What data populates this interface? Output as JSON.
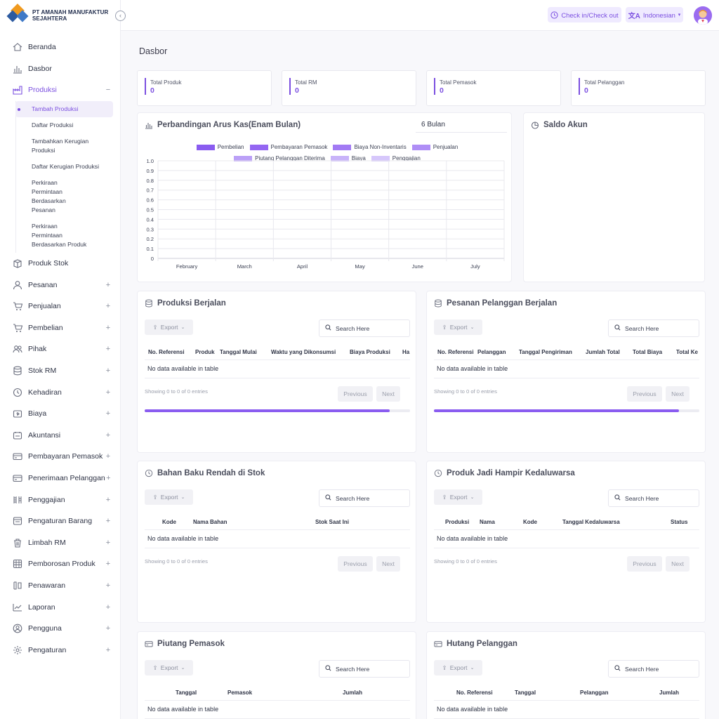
{
  "brand": {
    "name": "PT AMANAH MANUFAKTUR SEJAHTERA"
  },
  "topbar": {
    "check_label": "Check in/Check out",
    "lang_label": "Indonesian"
  },
  "sidebar": {
    "items": [
      {
        "label": "Beranda",
        "icon": "home-icon"
      },
      {
        "label": "Dasbor",
        "icon": "chart-icon"
      },
      {
        "label": "Produksi",
        "icon": "factory-icon",
        "toggle": "−"
      },
      {
        "label": "Produk Stok",
        "icon": "box-icon"
      },
      {
        "label": "Pesanan",
        "icon": "user-icon",
        "toggle": "+"
      },
      {
        "label": "Penjualan",
        "icon": "cart-icon",
        "toggle": "+"
      },
      {
        "label": "Pembelian",
        "icon": "cart-icon",
        "toggle": "+"
      },
      {
        "label": "Pihak",
        "icon": "users-icon",
        "toggle": "+"
      },
      {
        "label": "Stok RM",
        "icon": "database-icon",
        "toggle": "+"
      },
      {
        "label": "Kehadiran",
        "icon": "clock-icon",
        "toggle": "+"
      },
      {
        "label": "Biaya",
        "icon": "wallet-icon",
        "toggle": "+"
      },
      {
        "label": "Akuntansi",
        "icon": "calculator-icon",
        "toggle": "+"
      },
      {
        "label": "Pembayaran Pemasok",
        "icon": "card-icon",
        "toggle": "+"
      },
      {
        "label": "Penerimaan Pelanggan",
        "icon": "card-icon",
        "toggle": "+"
      },
      {
        "label": "Penggajian",
        "icon": "payroll-icon",
        "toggle": "+"
      },
      {
        "label": "Pengaturan Barang",
        "icon": "settings-box-icon",
        "toggle": "+"
      },
      {
        "label": "Limbah RM",
        "icon": "trash-icon",
        "toggle": "+"
      },
      {
        "label": "Pemborosan Produk",
        "icon": "waste-icon",
        "toggle": "+"
      },
      {
        "label": "Penawaran",
        "icon": "offer-icon",
        "toggle": "+"
      },
      {
        "label": "Laporan",
        "icon": "report-icon",
        "toggle": "+"
      },
      {
        "label": "Pengguna",
        "icon": "user-circle-icon",
        "toggle": "+"
      },
      {
        "label": "Pengaturan",
        "icon": "gear-icon",
        "toggle": "+"
      }
    ],
    "produksi_sub": [
      "Tambah Produksi",
      "Daftar Produksi",
      "Tambahkan Kerugian Produksi",
      "Daftar Kerugian Produksi",
      "Perkiraan Permintaan Berdasarkan Pesanan",
      "Perkiraan Permintaan Berdasarkan Produk"
    ]
  },
  "main": {
    "title": "Dasbor",
    "stats": [
      {
        "label": "Total Produk",
        "value": "0"
      },
      {
        "label": "Total RM",
        "value": "0"
      },
      {
        "label": "Total Pemasok",
        "value": "0"
      },
      {
        "label": "Total Pelanggan",
        "value": "0"
      }
    ],
    "cashflow": {
      "title": "Perbandingan Arus Kas(Enam Bulan)",
      "period": "6 Bulan"
    },
    "saldo": {
      "title": "Saldo Akun"
    },
    "export_label": "Export",
    "search_label": "Search Here",
    "nodata": "No data available in table",
    "showing": "Showing 0 to 0 of 0 entries",
    "previous": "Previous",
    "next": "Next",
    "tables": [
      {
        "title": "Produksi Berjalan",
        "headers": [
          "No. Referensi",
          "Produk",
          "Tanggal Mulai",
          "Waktu yang Dikonsumsi",
          "Biaya Produksi",
          "Ha"
        ]
      },
      {
        "title": "Pesanan Pelanggan Berjalan",
        "headers": [
          "No. Referensi",
          "Pelanggan",
          "Tanggal Pengiriman",
          "Jumlah Total",
          "Total Biaya",
          "Total Ke"
        ]
      },
      {
        "title": "Bahan Baku Rendah di Stok",
        "headers": [
          "Kode",
          "Nama Bahan",
          "Stok Saat Ini"
        ]
      },
      {
        "title": "Produk Jadi Hampir Kedaluwarsa",
        "headers": [
          "Produksi",
          "Nama",
          "Kode",
          "Tanggal Kedaluwarsa",
          "Status"
        ]
      },
      {
        "title": "Piutang Pemasok",
        "headers": [
          "Tanggal",
          "Pemasok",
          "Jumlah"
        ]
      },
      {
        "title": "Hutang Pelanggan",
        "headers": [
          "No. Referensi",
          "Tanggal",
          "Pelanggan",
          "Jumlah"
        ]
      }
    ]
  },
  "chart_data": {
    "type": "bar",
    "title": "Perbandingan Arus Kas(Enam Bulan)",
    "categories": [
      "February",
      "March",
      "April",
      "May",
      "June",
      "July"
    ],
    "series": [
      {
        "name": "Pembelian",
        "color": "#8a5cf0",
        "values": [
          0,
          0,
          0,
          0,
          0,
          0
        ]
      },
      {
        "name": "Pembayaran Pemasok",
        "color": "#9466f2",
        "values": [
          0,
          0,
          0,
          0,
          0,
          0
        ]
      },
      {
        "name": "Biaya Non-Inventaris",
        "color": "#a27af4",
        "values": [
          0,
          0,
          0,
          0,
          0,
          0
        ]
      },
      {
        "name": "Penjualan",
        "color": "#af8ef6",
        "values": [
          0,
          0,
          0,
          0,
          0,
          0
        ]
      },
      {
        "name": "Piutang Pelanggan Diterima",
        "color": "#bba0f7",
        "values": [
          0,
          0,
          0,
          0,
          0,
          0
        ]
      },
      {
        "name": "Biaya",
        "color": "#c8b3f9",
        "values": [
          0,
          0,
          0,
          0,
          0,
          0
        ]
      },
      {
        "name": "Penggajian",
        "color": "#d6c7fb",
        "values": [
          0,
          0,
          0,
          0,
          0,
          0
        ]
      }
    ],
    "yticks": [
      "1.0",
      "0.9",
      "0.8",
      "0.7",
      "0.6",
      "0.5",
      "0.4",
      "0.3",
      "0.2",
      "0.1",
      "0"
    ],
    "ylim": [
      0,
      1
    ],
    "grid": true,
    "legend": "top"
  }
}
